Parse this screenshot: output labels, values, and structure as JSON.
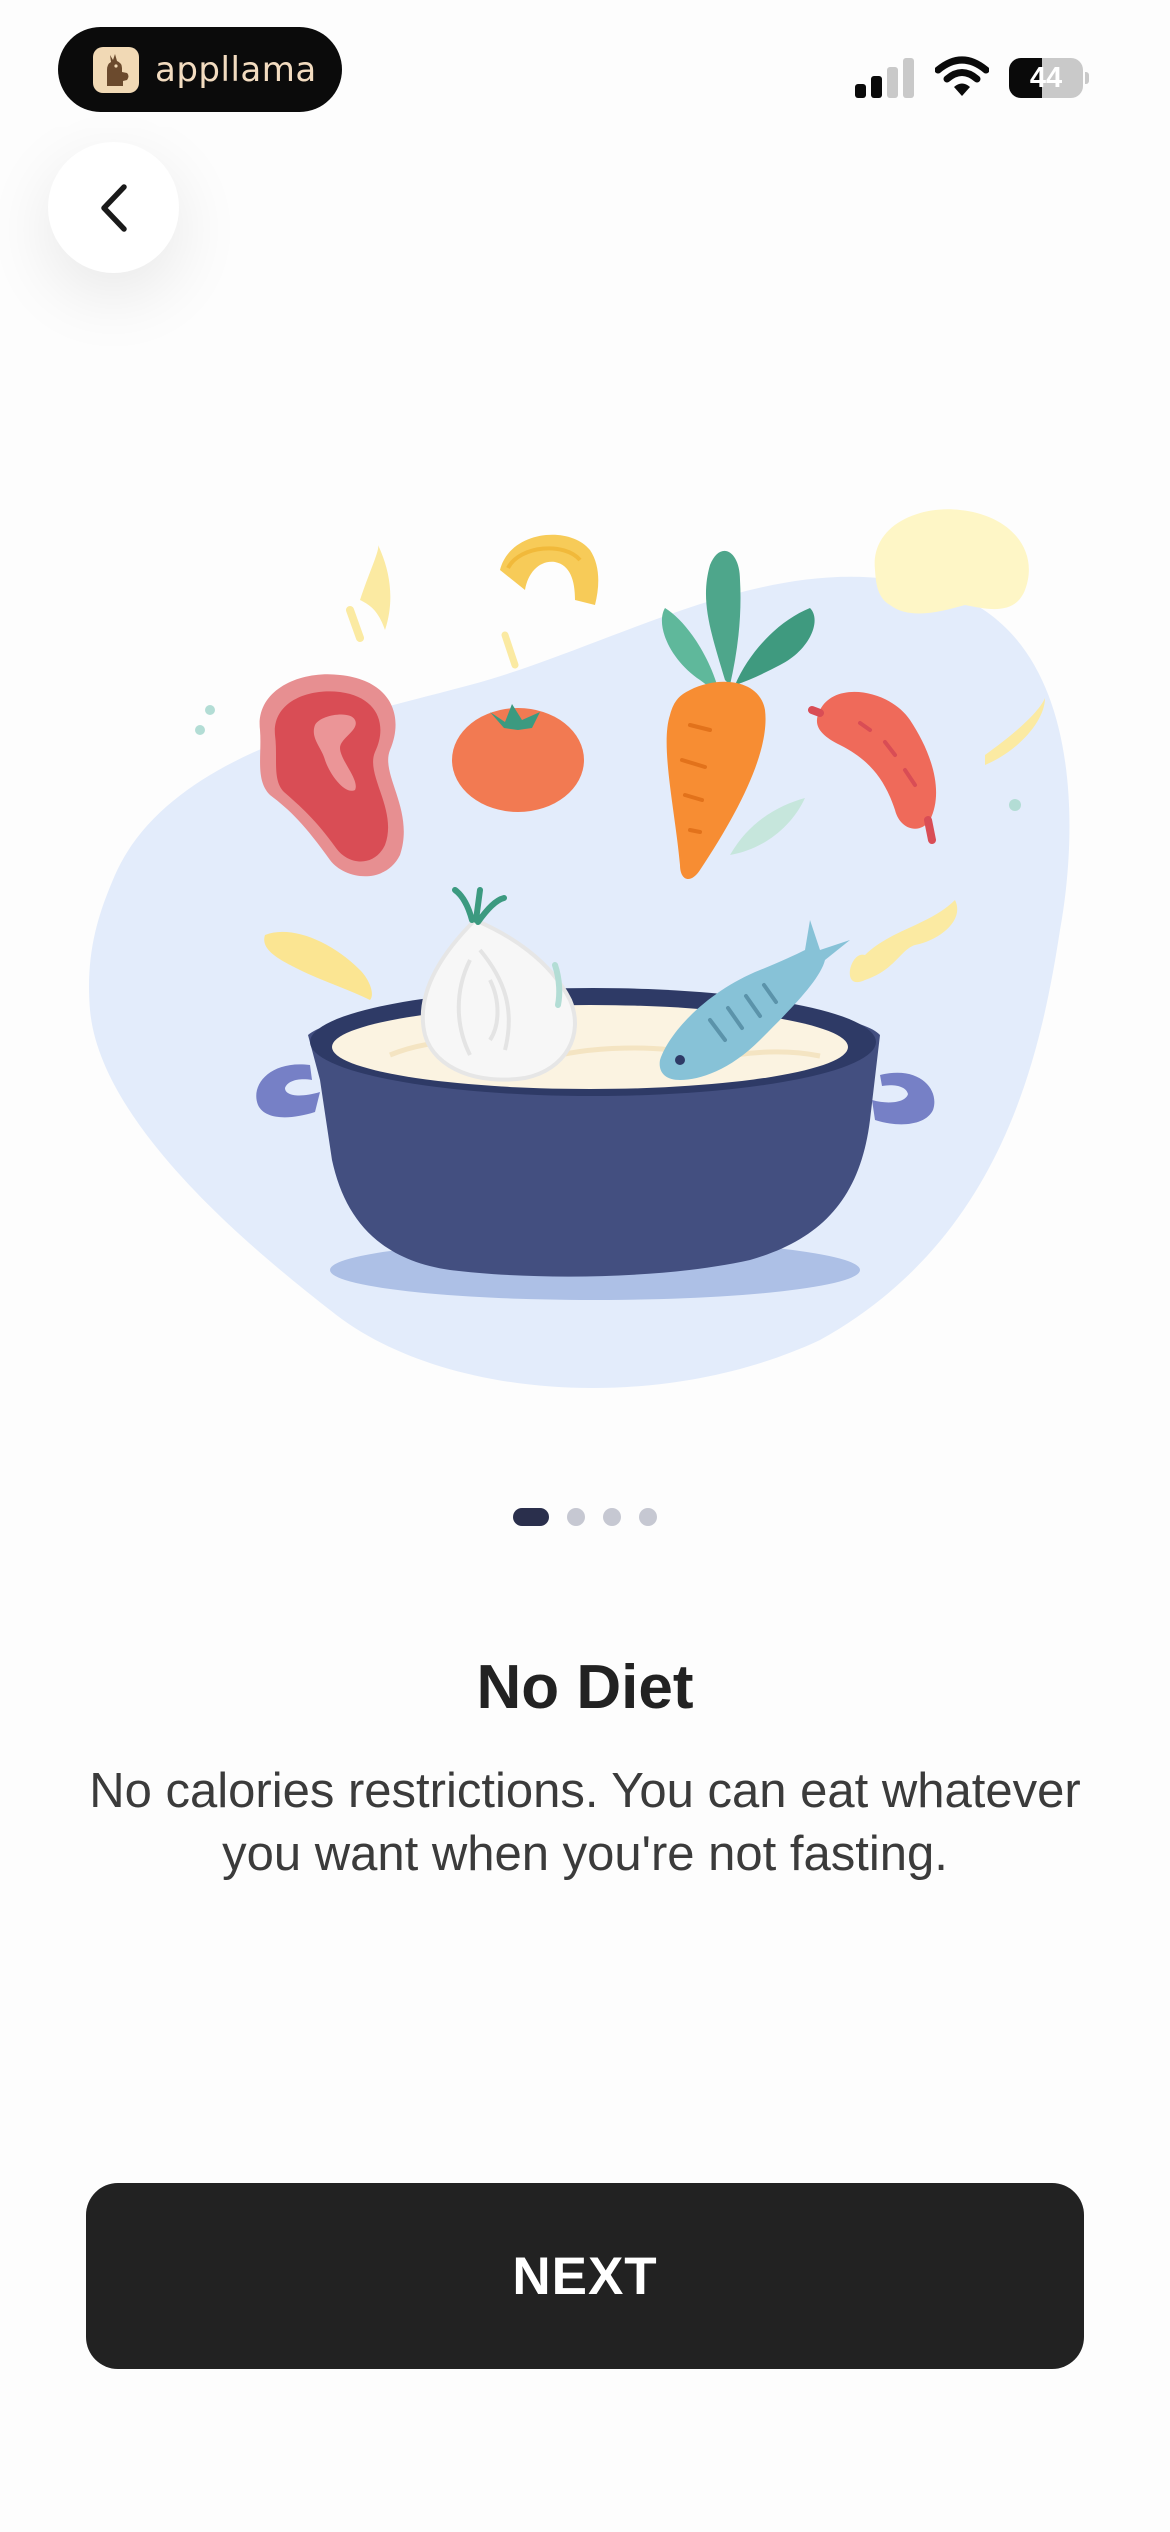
{
  "status_bar": {
    "brand_name": "appllama",
    "battery_level": "44",
    "battery_fraction": 0.44,
    "signal_icon": "cellular-signal-icon",
    "wifi_icon": "wifi-icon",
    "battery_icon": "battery-icon"
  },
  "navigation": {
    "back_icon": "chevron-left-icon"
  },
  "illustration": {
    "name": "cooking-pot-illustration"
  },
  "pager": {
    "total": 4,
    "active_index": 0
  },
  "content": {
    "title": "No Diet",
    "description": "No calories restrictions. You can eat whatever you want when you're not fasting."
  },
  "actions": {
    "next_label": "NEXT"
  },
  "colors": {
    "button_bg": "#222222",
    "pager_active": "#2a2f4c",
    "pager_inactive": "#c6c8d2",
    "pot": "#434f80",
    "background_blob": "#e3ecfb"
  }
}
